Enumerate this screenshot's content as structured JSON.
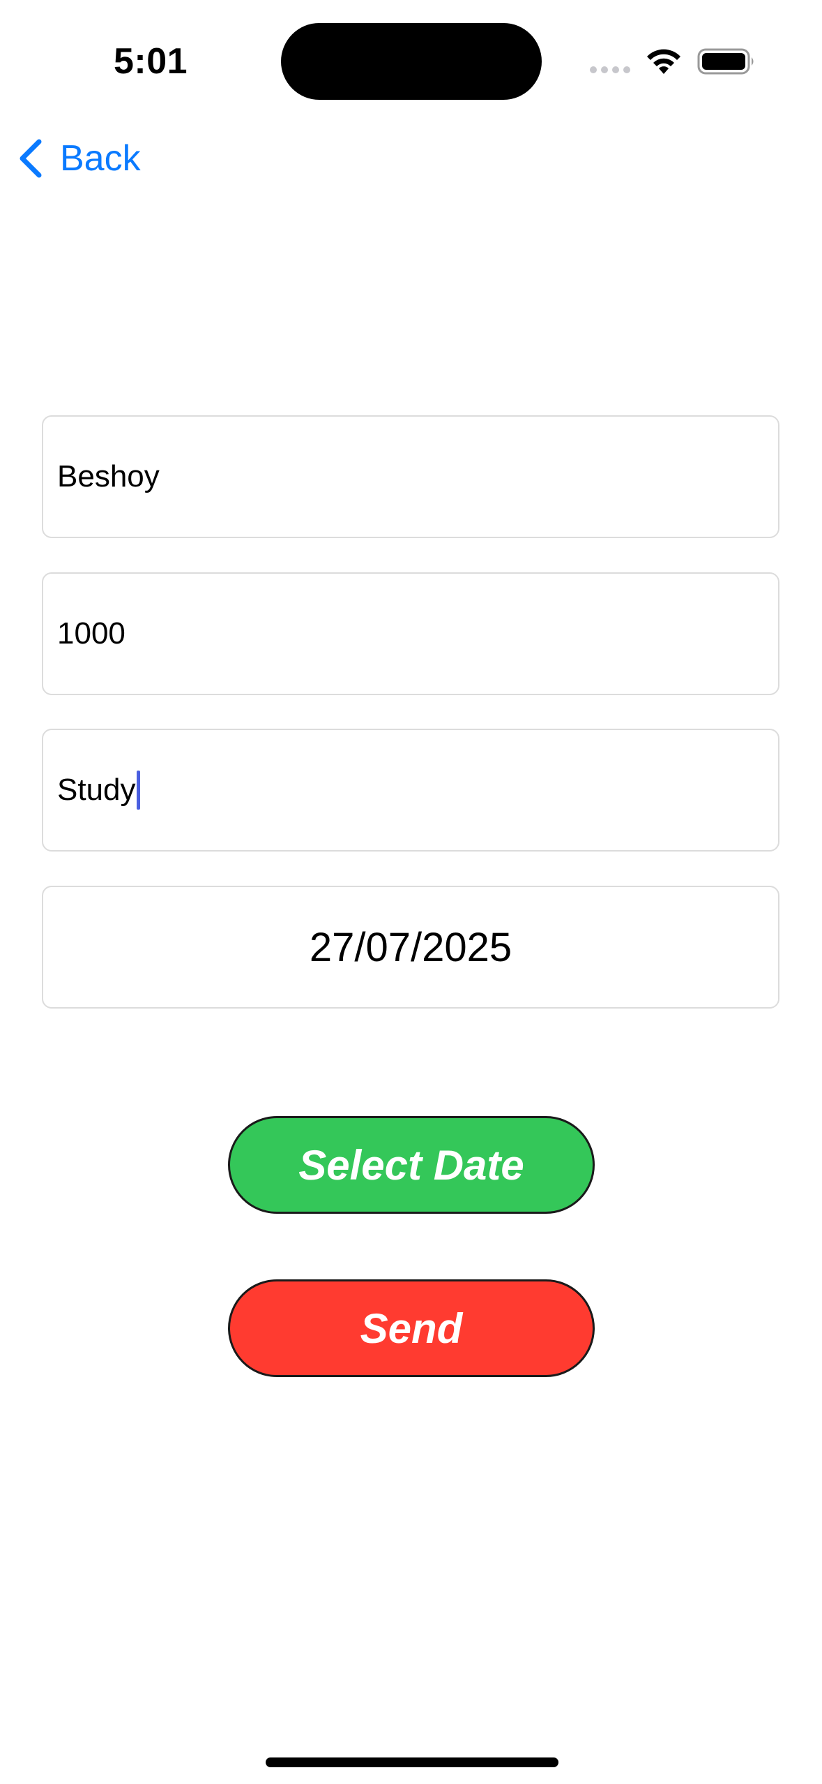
{
  "status_bar": {
    "time": "5:01"
  },
  "nav": {
    "back_label": "Back"
  },
  "form": {
    "name_value": "Beshoy",
    "amount_value": "1000",
    "purpose_value": "Study",
    "date_value": "27/07/2025"
  },
  "buttons": {
    "select_date_label": "Select Date",
    "send_label": "Send"
  },
  "colors": {
    "accent": "#0a7aff",
    "select_date_bg": "#34c759",
    "send_bg": "#ff3b30"
  }
}
